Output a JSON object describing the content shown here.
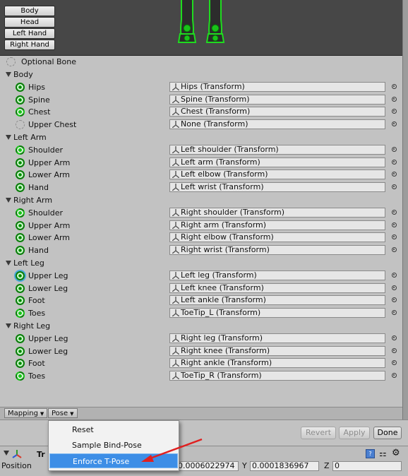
{
  "preview": {
    "body_parts": [
      "Body",
      "Head",
      "Left Hand",
      "Right Hand"
    ],
    "active_part": "Body"
  },
  "optional_bone_legend": "Optional Bone",
  "groups": [
    {
      "name": "Body",
      "bones": [
        {
          "label": "Hips",
          "value": "Hips (Transform)",
          "state": "required"
        },
        {
          "label": "Spine",
          "value": "Spine (Transform)",
          "state": "required"
        },
        {
          "label": "Chest",
          "value": "Chest (Transform)",
          "state": "optional"
        },
        {
          "label": "Upper Chest",
          "value": "None (Transform)",
          "state": "empty"
        }
      ]
    },
    {
      "name": "Left Arm",
      "bones": [
        {
          "label": "Shoulder",
          "value": "Left shoulder (Transform)",
          "state": "optional"
        },
        {
          "label": "Upper Arm",
          "value": "Left arm (Transform)",
          "state": "required"
        },
        {
          "label": "Lower Arm",
          "value": "Left elbow (Transform)",
          "state": "required"
        },
        {
          "label": "Hand",
          "value": "Left wrist (Transform)",
          "state": "required"
        }
      ]
    },
    {
      "name": "Right Arm",
      "bones": [
        {
          "label": "Shoulder",
          "value": "Right shoulder (Transform)",
          "state": "optional"
        },
        {
          "label": "Upper Arm",
          "value": "Right arm (Transform)",
          "state": "required"
        },
        {
          "label": "Lower Arm",
          "value": "Right elbow (Transform)",
          "state": "required"
        },
        {
          "label": "Hand",
          "value": "Right wrist (Transform)",
          "state": "required"
        }
      ]
    },
    {
      "name": "Left Leg",
      "bones": [
        {
          "label": "Upper Leg",
          "value": "Left leg (Transform)",
          "state": "required",
          "selected": true
        },
        {
          "label": "Lower Leg",
          "value": "Left knee (Transform)",
          "state": "required"
        },
        {
          "label": "Foot",
          "value": "Left ankle (Transform)",
          "state": "required"
        },
        {
          "label": "Toes",
          "value": "ToeTip_L (Transform)",
          "state": "optional"
        }
      ]
    },
    {
      "name": "Right Leg",
      "bones": [
        {
          "label": "Upper Leg",
          "value": "Right leg (Transform)",
          "state": "required"
        },
        {
          "label": "Lower Leg",
          "value": "Right knee (Transform)",
          "state": "required"
        },
        {
          "label": "Foot",
          "value": "Right ankle (Transform)",
          "state": "required"
        },
        {
          "label": "Toes",
          "value": "ToeTip_R (Transform)",
          "state": "optional"
        }
      ]
    }
  ],
  "toolbar": {
    "mapping_label": "Mapping",
    "pose_label": "Pose"
  },
  "actions": {
    "revert": "Revert",
    "apply": "Apply",
    "done": "Done"
  },
  "popup_menu": {
    "items": [
      "Reset",
      "Sample Bind-Pose",
      "Enforce T-Pose"
    ],
    "highlighted": "Enforce T-Pose"
  },
  "inspector": {
    "component_label": "Tr",
    "position_label": "Position",
    "x_value": "0.0006022974",
    "y_label": "Y",
    "y_value": "0.0001836967",
    "z_label": "Z",
    "z_value": "0"
  },
  "colors": {
    "bone_green": "#19c219",
    "menu_highlight": "#3d8ee6",
    "arrow_red": "#e02020"
  }
}
